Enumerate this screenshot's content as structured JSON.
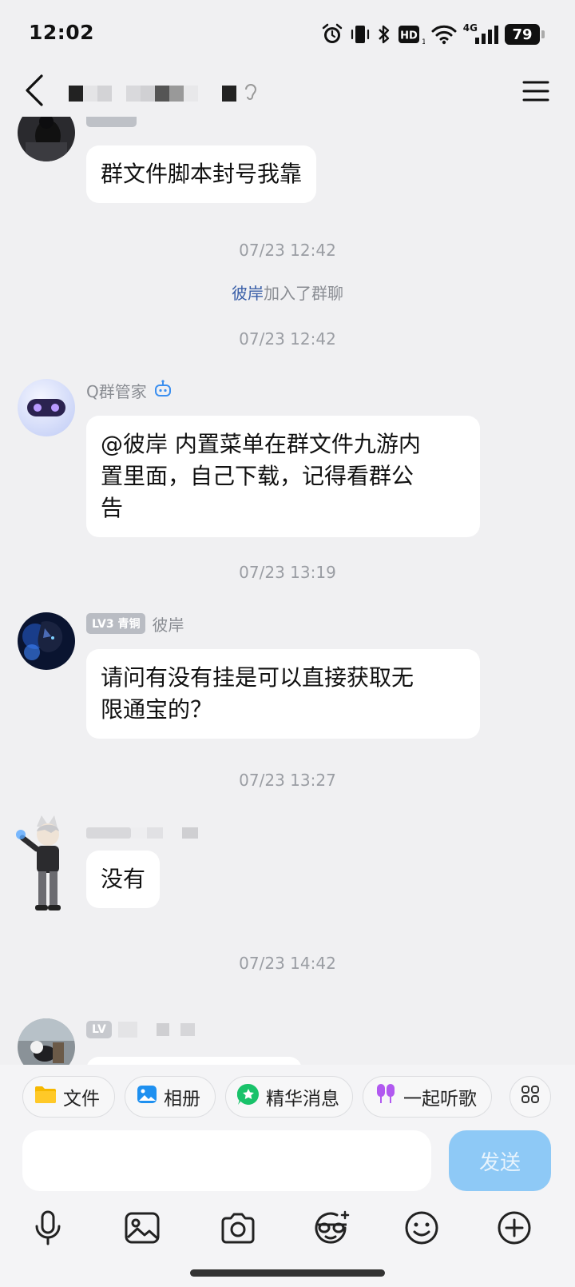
{
  "status_bar": {
    "time": "12:02",
    "battery": "79",
    "network": "4G",
    "icons": [
      "alarm-icon",
      "vibrate-icon",
      "bluetooth-icon",
      "hd-icon",
      "wifi-icon",
      "signal-icon",
      "battery-icon"
    ]
  },
  "header": {
    "back_icon": "chevron-left-icon",
    "title": "",
    "menu_icon": "hamburger-menu-icon"
  },
  "messages": [
    {
      "type": "text",
      "sender": "",
      "badge": "",
      "text": "群文件脚本封号我靠"
    },
    {
      "type": "timestamp",
      "text": "07/23 12:42"
    },
    {
      "type": "system",
      "who": "彼岸",
      "text": "加入了群聊"
    },
    {
      "type": "timestamp",
      "text": "07/23 12:42"
    },
    {
      "type": "text",
      "sender": "Q群管家",
      "badge": "",
      "bot_icon": "robot-icon",
      "text": "@彼岸 内置菜单在群文件九游内置里面，自己下载，记得看群公告",
      "lines": [
        "@彼岸 内置菜单在群文件九游内",
        "置里面，自己下载，记得看群公",
        "告"
      ]
    },
    {
      "type": "timestamp",
      "text": "07/23 13:19"
    },
    {
      "type": "text",
      "sender": "彼岸",
      "badge": "LV3 青铜",
      "text": "请问有没有挂是可以直接获取无限通宝的？",
      "lines": [
        "请问有没有挂是可以直接获取无",
        "限通宝的？"
      ]
    },
    {
      "type": "timestamp",
      "text": "07/23 13:27"
    },
    {
      "type": "text",
      "sender": "",
      "badge": "",
      "text": "没有"
    },
    {
      "type": "timestamp",
      "text": "07/23 14:42"
    },
    {
      "type": "text",
      "sender": "",
      "badge": "LV",
      "text": ""
    }
  ],
  "quick_bar": [
    {
      "label": "文件",
      "icon": "folder-icon"
    },
    {
      "label": "相册",
      "icon": "photo-album-icon"
    },
    {
      "label": "精华消息",
      "icon": "essence-star-icon"
    },
    {
      "label": "一起听歌",
      "icon": "earphones-icon"
    },
    {
      "label": "",
      "icon": "grid-more-icon"
    }
  ],
  "input": {
    "placeholder": "",
    "value": "",
    "send_label": "发送"
  },
  "toolbar": [
    "microphone-icon",
    "image-icon",
    "camera-icon",
    "sticker-face-icon",
    "emoji-icon",
    "plus-circle-icon"
  ],
  "colors": {
    "background": "#f0f0f2",
    "bubble": "#ffffff",
    "send_button": "#8ec9f6",
    "system_name": "#3a5fa8",
    "timestamp": "#9a9da3"
  }
}
